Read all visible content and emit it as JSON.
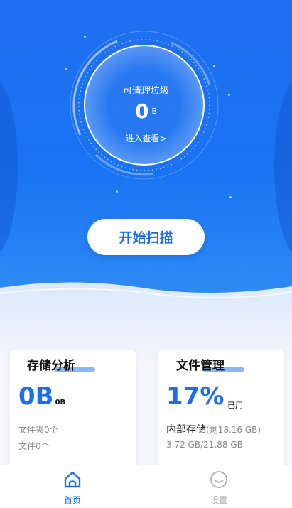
{
  "gauge": {
    "title": "可清理垃圾",
    "value": "0",
    "unit": "B",
    "link": "进入查看>"
  },
  "scan_button": {
    "label": "开始扫描"
  },
  "storage_card": {
    "title": "存储分析",
    "value": "0B",
    "value_suffix": "0B",
    "folders": "文件夹0个",
    "files": "文件0个"
  },
  "files_card": {
    "title": "文件管理",
    "percent": "17%",
    "used_label": "已用",
    "storage_name": "内部存储",
    "remaining": "(剩18.16 GB)",
    "usage": "3.72 GB/21.88 GB"
  },
  "tabs": [
    {
      "label": "首页",
      "icon": "home-icon",
      "active": true
    },
    {
      "label": "设置",
      "icon": "smile-icon",
      "active": false
    }
  ],
  "colors": {
    "primary": "#1b6df1",
    "hero": "#1f6ff0"
  }
}
